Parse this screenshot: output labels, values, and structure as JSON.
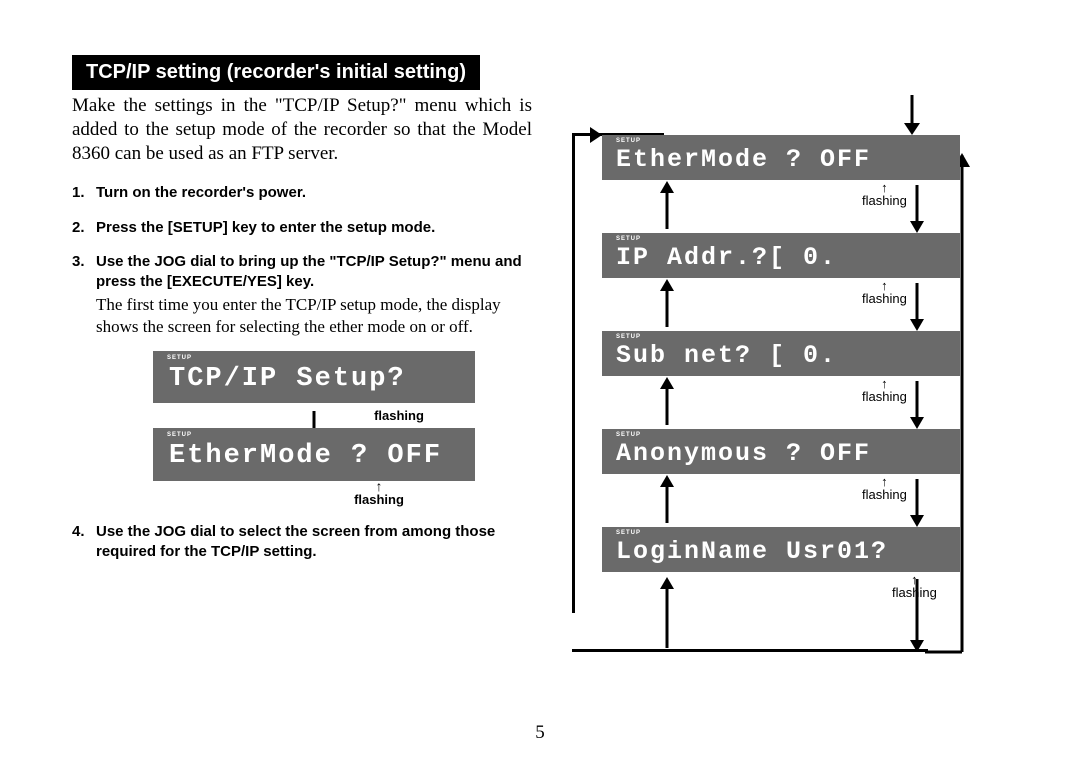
{
  "header": "TCP/IP setting (recorder's initial setting)",
  "intro": "Make the settings in the \"TCP/IP Setup?\" menu which is added to the setup mode of the recorder so that the Model 8360 can be used as an FTP server.",
  "steps": {
    "s1": "Turn on the recorder's power.",
    "s2": "Press the [SETUP] key to enter the setup mode.",
    "s3": "Use the JOG dial to bring up the \"TCP/IP Setup?\" menu and press the [EXECUTE/YES] key.",
    "s3_note": "The first time you enter the TCP/IP setup mode, the display shows the screen for selecting the ether mode on or off.",
    "s4": "Use the JOG dial to select the screen from among those required for the TCP/IP setting."
  },
  "lcd_left": {
    "setup_tag": "SETUP",
    "screen1": "TCP/IP Setup?",
    "screen2": "EtherMode ?  OFF"
  },
  "flash_label": "flashing",
  "lcd_right": {
    "r1": "EtherMode ?  OFF",
    "r2": "IP Addr.?[   0.",
    "r3": "Sub net? [   0.",
    "r4": "Anonymous ?  OFF",
    "r5": "LoginName Usr01?"
  },
  "page_number": "5"
}
